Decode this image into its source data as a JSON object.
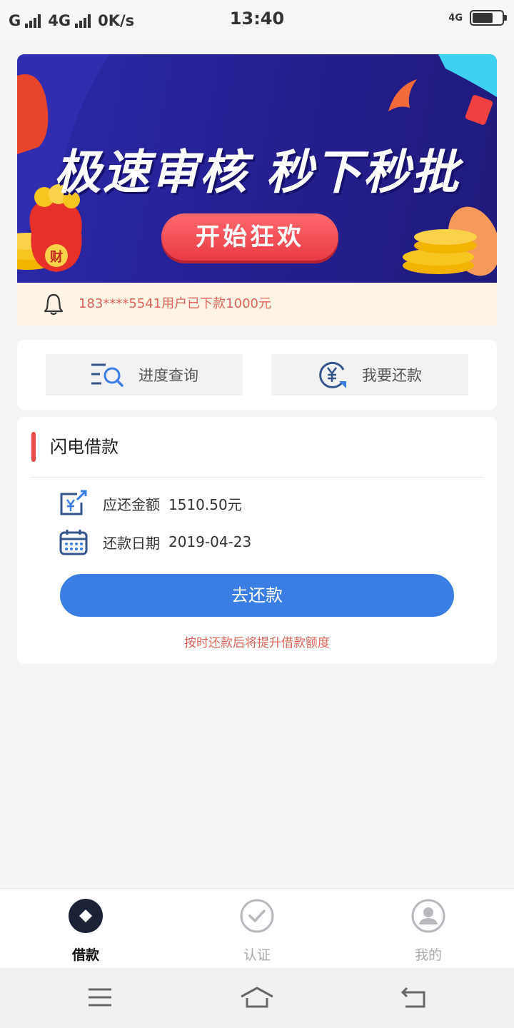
{
  "status_bar": {
    "carrier1": "G",
    "carrier2": "4G",
    "speed": "0K/s",
    "time": "13:40",
    "network": "4G",
    "battery_level": 0.7
  },
  "banner": {
    "headline": "极速审核 秒下秒批",
    "cta_label": "开始狂欢",
    "coin_glyph": "财"
  },
  "notice": {
    "icon": "bell-icon",
    "text": "183****5541用户已下款1000元"
  },
  "actions": [
    {
      "icon": "search-list-icon",
      "label": "进度查询"
    },
    {
      "icon": "yuan-repay-icon",
      "label": "我要还款"
    }
  ],
  "loan": {
    "title": "闪电借款",
    "amount_label": "应还金额",
    "amount_value": "1510.50元",
    "date_label": "还款日期",
    "date_value": "2019-04-23",
    "pay_button": "去还款",
    "hint": "按时还款后将提升借款额度"
  },
  "tabs": [
    {
      "icon": "loan-diamond-icon",
      "label": "借款",
      "active": true
    },
    {
      "icon": "check-circle-icon",
      "label": "认证",
      "active": false
    },
    {
      "icon": "user-icon",
      "label": "我的",
      "active": false
    }
  ],
  "colors": {
    "primary": "#3a7ee3",
    "accent_red": "#e84a4a",
    "banner_bg": "#262094",
    "notice_bg": "#fdf4e6"
  }
}
